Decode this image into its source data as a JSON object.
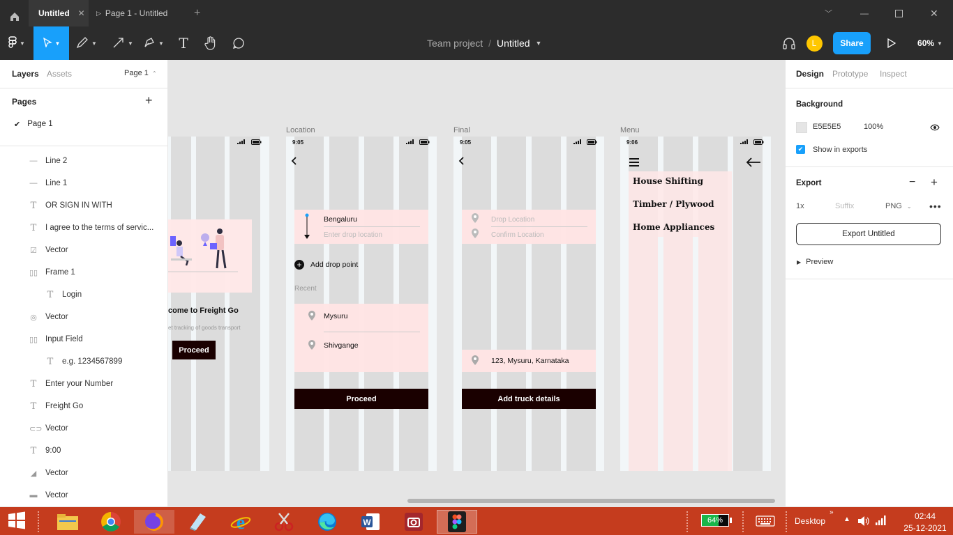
{
  "titlebar": {
    "tabs": [
      {
        "label": "Untitled",
        "active": true
      },
      {
        "label": "Page 1 - Untitled",
        "active": false
      }
    ],
    "add_tab": "+"
  },
  "toolbar": {
    "breadcrumb_team": "Team project",
    "breadcrumb_sep": "/",
    "file_name": "Untitled",
    "avatar_letter": "L",
    "share_label": "Share",
    "zoom": "60%"
  },
  "left_panel": {
    "tabs": [
      "Layers",
      "Assets"
    ],
    "page_selector": "Page 1",
    "pages_heading": "Pages",
    "pages": [
      "Page 1"
    ],
    "layers": [
      {
        "icon": "line-icon",
        "label": "Line 2",
        "indent": 0
      },
      {
        "icon": "line-icon",
        "label": "Line 1",
        "indent": 0
      },
      {
        "icon": "text-icon",
        "label": "OR SIGN IN WITH",
        "indent": 0
      },
      {
        "icon": "text-icon",
        "label": "I agree to the terms of servic...",
        "indent": 0
      },
      {
        "icon": "checkbox-vector-icon",
        "label": "Vector",
        "indent": 0
      },
      {
        "icon": "frame-icon",
        "label": "Frame 1",
        "indent": 0
      },
      {
        "icon": "text-icon",
        "label": "Login",
        "indent": 1
      },
      {
        "icon": "radio-vector-icon",
        "label": "Vector",
        "indent": 0
      },
      {
        "icon": "frame-icon",
        "label": "Input Field",
        "indent": 0
      },
      {
        "icon": "text-icon",
        "label": "e.g. 1234567899",
        "indent": 1
      },
      {
        "icon": "text-icon",
        "label": "Enter your Number",
        "indent": 0
      },
      {
        "icon": "text-icon",
        "label": "Freight Go",
        "indent": 0
      },
      {
        "icon": "link-vector-icon",
        "label": "Vector",
        "indent": 0
      },
      {
        "icon": "text-icon",
        "label": "9:00",
        "indent": 0
      },
      {
        "icon": "signal-vector-icon",
        "label": "Vector",
        "indent": 0
      },
      {
        "icon": "battery-vector-icon",
        "label": "Vector",
        "indent": 0
      }
    ]
  },
  "right_panel": {
    "tabs": [
      "Design",
      "Prototype",
      "Inspect"
    ],
    "background_heading": "Background",
    "bg_hex": "E5E5E5",
    "bg_opacity": "100%",
    "show_in_exports": "Show in exports",
    "export_heading": "Export",
    "export_scale": "1x",
    "export_suffix_placeholder": "Suffix",
    "export_format": "PNG",
    "export_button": "Export Untitled",
    "preview_label": "Preview"
  },
  "canvas": {
    "frame_labels": [
      "Location",
      "Final",
      "Menu"
    ],
    "welcome_frame": {
      "title": "come to Freight Go",
      "subtitle": "et tracking of goods transport",
      "button": "Proceed"
    },
    "location_frame": {
      "time": "9:05",
      "from": "Bengaluru",
      "to_placeholder": "Enter drop location",
      "add_drop": "Add drop point",
      "recent_heading": "Recent",
      "recent": [
        "Mysuru",
        "Shivgange"
      ],
      "button": "Proceed"
    },
    "final_frame": {
      "time": "9:05",
      "drop_placeholder": "Drop Location",
      "confirm_placeholder": "Confirm Location",
      "address": "123, Mysuru, Karnataka",
      "button": "Add truck details"
    },
    "menu_frame": {
      "time": "9:06",
      "items": [
        "House Shifting",
        "Timber / Plywood",
        "Home Appliances"
      ]
    },
    "help": "?"
  },
  "taskbar": {
    "battery": "64%",
    "desktop_label": "Desktop",
    "time": "02:44",
    "date": "25-12-2021"
  },
  "colors": {
    "chrome": "#2c2c2c",
    "accent": "#18a0fb",
    "avatar": "#ffc700",
    "taskbar": "#c53c1e",
    "pink": "#ffe4e4",
    "dark_button": "#1a0000"
  }
}
